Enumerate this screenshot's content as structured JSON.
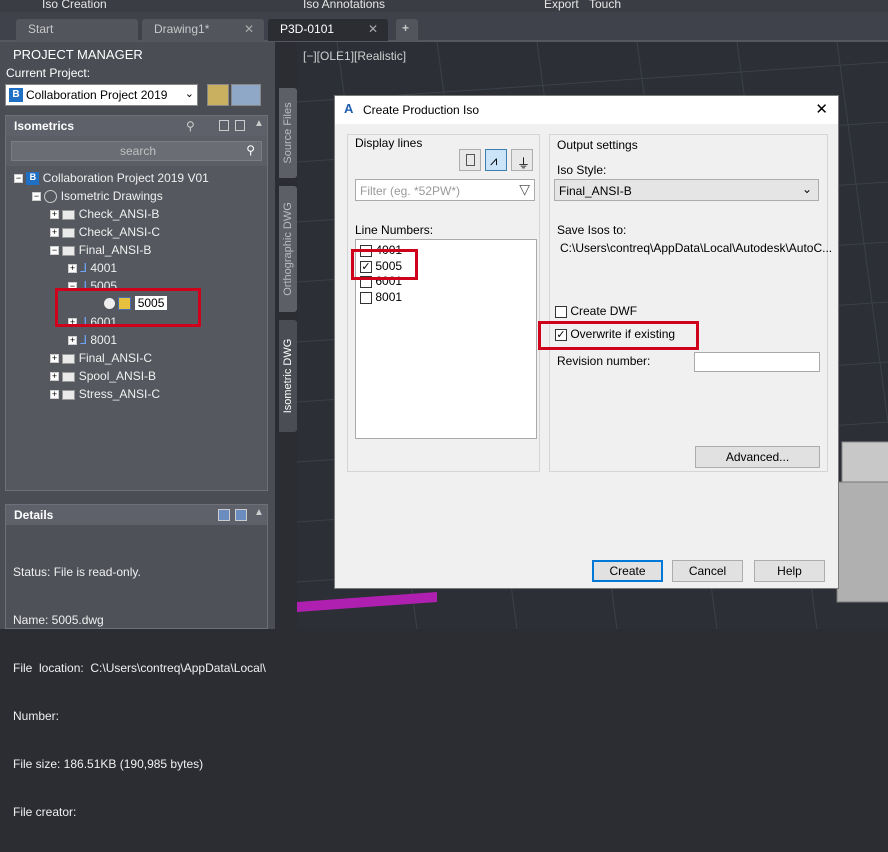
{
  "ribbon": {
    "items": [
      "Iso Creation",
      "Iso Annotations",
      "Export",
      "Touch"
    ]
  },
  "tabs": [
    {
      "label": "Start"
    },
    {
      "label": "Drawing1*"
    },
    {
      "label": "P3D-0101"
    },
    {
      "label": "+"
    }
  ],
  "project_manager": {
    "title": "PROJECT MANAGER",
    "current_project_label": "Current Project:",
    "current_project_value": "Collaboration Project  2019",
    "isometrics_title": "Isometrics",
    "search_placeholder": "search",
    "tree": [
      {
        "label": "Collaboration Project  2019 V01"
      },
      {
        "label": "Isometric Drawings"
      },
      {
        "label": "Check_ANSI-B"
      },
      {
        "label": "Check_ANSI-C"
      },
      {
        "label": "Final_ANSI-B"
      },
      {
        "label": "4001"
      },
      {
        "label": "5005"
      },
      {
        "label": "5005"
      },
      {
        "label": "6001"
      },
      {
        "label": "8001"
      },
      {
        "label": "Final_ANSI-C"
      },
      {
        "label": "Spool_ANSI-B"
      },
      {
        "label": "Stress_ANSI-C"
      }
    ],
    "details_title": "Details",
    "details": [
      "Status: File is read-only.",
      "Name: 5005.dwg",
      "File  location:  C:\\Users\\contreq\\AppData\\Local\\",
      "Number:",
      "File size: 186.51KB (190,985 bytes)",
      "File creator:"
    ]
  },
  "side_tabs": [
    "Source Files",
    "Orthographic DWG",
    "Isometric DWG"
  ],
  "viewport": {
    "label": "[−][OLE1][Realistic]"
  },
  "dialog": {
    "title": "Create Production Iso",
    "display_lines": "Display lines",
    "filter_placeholder": "Filter (eg. *52PW*)",
    "line_numbers_label": "Line Numbers:",
    "lines": [
      {
        "label": "4001",
        "checked": false
      },
      {
        "label": "5005",
        "checked": true
      },
      {
        "label": "6001",
        "checked": false
      },
      {
        "label": "8001",
        "checked": false
      }
    ],
    "output_settings": "Output settings",
    "iso_style_label": "Iso Style:",
    "iso_style_value": "Final_ANSI-B",
    "save_isos_label": "Save Isos to:",
    "save_isos_path": "C:\\Users\\contreq\\AppData\\Local\\Autodesk\\AutoC...",
    "create_dwf": "Create DWF",
    "overwrite": "Overwrite if existing",
    "revision_label": "Revision number:",
    "revision_value": "",
    "advanced": "Advanced...",
    "create": "Create",
    "cancel": "Cancel",
    "help": "Help"
  }
}
